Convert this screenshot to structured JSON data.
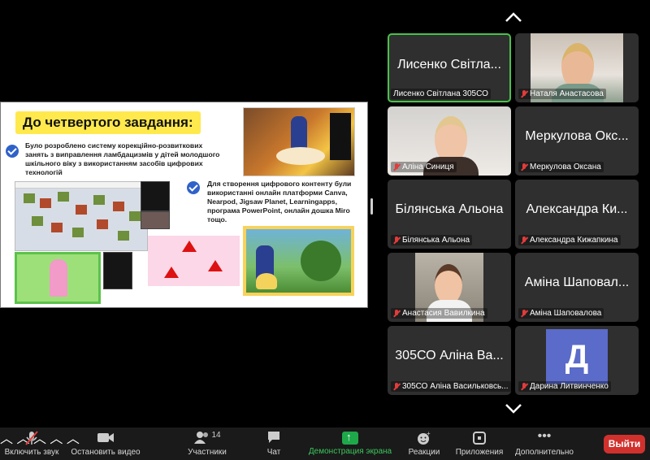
{
  "slide": {
    "title": "До четвертого завдання:",
    "paragraph1": "Було розроблено систему корекційно-розвиткових занять з виправлення ламбдацизмів у дітей молодшого шкільного віку з використанням засобів цифрових технологій",
    "paragraph2": "Для створення цифрового  контенту були використанні онлайн платформи Canva, Nearpod, Jigsaw Planet, Learningapps, програма PowerPoint, онлайн дошка Miro тощо."
  },
  "participants": [
    {
      "display": "Лисенко Світла...",
      "label": "Лисенко Світлана 305СО",
      "active": true,
      "muted": false,
      "video": false
    },
    {
      "display": "",
      "label": "Наталя Анастасова",
      "muted": true,
      "video": true
    },
    {
      "display": "",
      "label": "Аліна Синиця",
      "muted": true,
      "video": true
    },
    {
      "display": "Меркулова Окс...",
      "label": "Меркулова Оксана",
      "muted": true,
      "video": false
    },
    {
      "display": "Білянська Альона",
      "label": "Білянська Альона",
      "muted": true,
      "video": false
    },
    {
      "display": "Александра Ки...",
      "label": "Александра Кижапкина",
      "muted": true,
      "video": false
    },
    {
      "display": "",
      "label": "Анастасия Вавилкина",
      "muted": true,
      "video": true
    },
    {
      "display": "Аміна Шаповал...",
      "label": "Аміна Шаповалова",
      "muted": true,
      "video": false
    },
    {
      "display": "305СО Аліна Ва...",
      "label": "305СО Аліна Васильковсь...",
      "muted": true,
      "video": false
    },
    {
      "display": "",
      "label": "Дарина Литвинченко",
      "muted": true,
      "video": false,
      "avatar_letter": "Д",
      "avatar_color": "#5a6bc9"
    }
  ],
  "toolbar": {
    "unmute": "Включить звук",
    "video": "Остановить видео",
    "participants": "Участники",
    "participants_count": "14",
    "chat": "Чат",
    "share": "Демонстрация экрана",
    "reactions": "Реакции",
    "apps": "Приложения",
    "more": "Дополнительно",
    "leave": "Выйти"
  },
  "colors": {
    "share_green": "#1ea84a",
    "active_border": "#4ac24a",
    "leave_red": "#d0312d",
    "muted_red": "#e23b3b",
    "title_yellow": "#ffe94d"
  }
}
